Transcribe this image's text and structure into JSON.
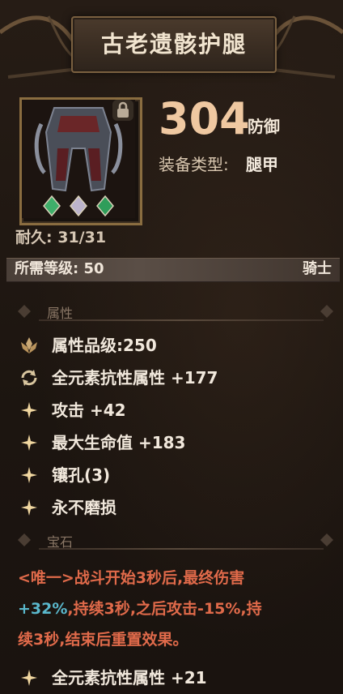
{
  "item": {
    "name": "古老遗骸护腿",
    "defense_value": "304",
    "defense_label": "防御",
    "type_label": "装备类型:",
    "type_value": "腿甲",
    "durability_label": "耐久:",
    "durability_value": "31/31",
    "req_label": "所需等级:",
    "req_value": "50",
    "class": "骑士",
    "locked": true
  },
  "sections": {
    "attributes_title": "属性",
    "gems_title": "宝石"
  },
  "attributes": [
    {
      "icon": "lotus-emblem-icon",
      "text": "属性品级:250"
    },
    {
      "icon": "cycle-arrows-icon",
      "text": "全元素抗性属性 +177"
    },
    {
      "icon": "sparkle-icon",
      "text": "攻击 +42"
    },
    {
      "icon": "sparkle-icon",
      "text": "最大生命值 +183"
    },
    {
      "icon": "sparkle-icon",
      "text": "镶孔(3)"
    },
    {
      "icon": "sparkle-icon",
      "text": "永不磨损"
    }
  ],
  "gem": {
    "line1": "<唯一>战斗开始3秒后,最终伤害",
    "line2a": "+32%",
    "line2b": ",持续3秒,之后攻击-15%,持",
    "line3": "续3秒,结束后重置效果。",
    "bonus_text": "全元素抗性属性 +21"
  },
  "colors": {
    "title_text": "#f1e4cf",
    "defense_number": "#efc8a1",
    "gem_description": "#e06a4a",
    "gem_highlight": "#5ab8cc",
    "sparkle_icon": "#f1d7a0"
  }
}
